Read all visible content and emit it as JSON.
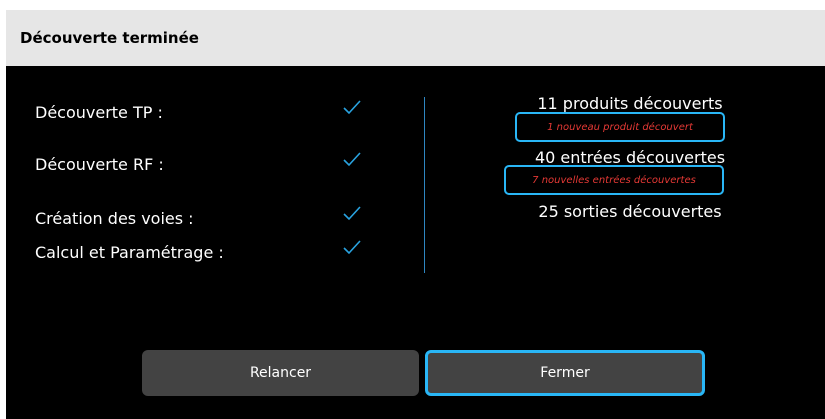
{
  "header": {
    "title": "Découverte terminée"
  },
  "steps": [
    {
      "label": "Découverte TP :",
      "icon": "checkmark-icon"
    },
    {
      "label": "Découverte RF :",
      "icon": "checkmark-icon"
    },
    {
      "label": "Création des voies :",
      "icon": "checkmark-icon"
    },
    {
      "label": "Calcul et Paramétrage :",
      "icon": "checkmark-icon"
    }
  ],
  "results": {
    "products": "11 produits découverts",
    "products_note": "1 nouveau produit découvert",
    "inputs": "40 entrées découvertes",
    "inputs_note": "7 nouvelles entrées découvertes",
    "outputs": "25 sorties découvertes"
  },
  "buttons": {
    "relaunch": "Relancer",
    "close": "Fermer"
  },
  "colors": {
    "accent": "#29b6f6",
    "check": "#29a3e0",
    "note_text": "#e53935",
    "button_bg": "#434343"
  }
}
